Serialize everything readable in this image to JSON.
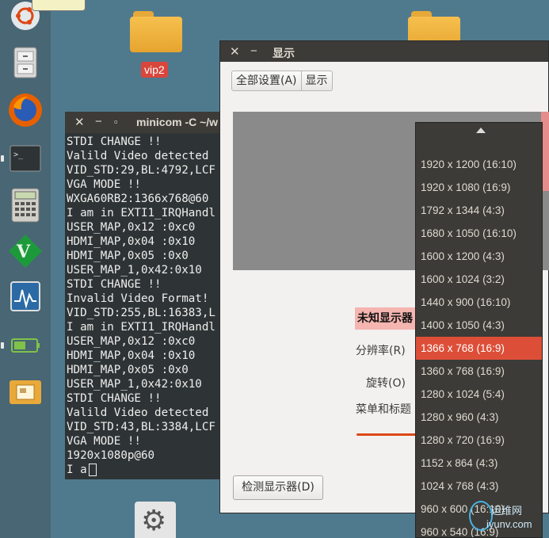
{
  "desktop": {
    "folders": [
      {
        "label": "vip2"
      },
      {
        "label": ""
      }
    ]
  },
  "terminal": {
    "title": "minicom -C ~/w",
    "lines": [
      "STDI CHANGE !!",
      "Valild Video detected",
      "VID_STD:29,BL:4792,LCF",
      "VGA MODE !!",
      "WXGA60RB2:1366x768@60",
      "I am in EXTI1_IRQHandl",
      "USER_MAP,0x12 :0xc0",
      "HDMI_MAP,0x04 :0x10",
      "HDMI_MAP,0x05 :0x0",
      "USER_MAP_1,0x42:0x10",
      "STDI CHANGE !!",
      "Invalid Video Format!",
      "VID_STD:255,BL:16383,L",
      "I am in EXTI1_IRQHandl",
      "USER_MAP,0x12 :0xc0",
      "HDMI_MAP,0x04 :0x10",
      "HDMI_MAP,0x05 :0x0",
      "USER_MAP_1,0x42:0x10",
      "STDI CHANGE !!",
      "Valild Video detected",
      "VID_STD:43,BL:3384,LCF",
      "VGA MODE !!",
      "1920x1080p@60",
      "I a"
    ]
  },
  "dialog": {
    "title": "显示",
    "nav": {
      "all_settings": "全部设置(A)",
      "current": "显示"
    },
    "monitor_name": "未知显示器",
    "resolution_label": "分辨率(R)",
    "rotation_label": "旋转(O)",
    "menu_title_label": "菜单和标题",
    "detect_button": "检测显示器(D)"
  },
  "resolution_menu": {
    "selected_index": 8,
    "options": [
      "1920 x 1200 (16:10)",
      "1920 x 1080 (16:9)",
      "1792 x 1344 (4:3)",
      "1680 x 1050 (16:10)",
      "1600 x 1200 (4:3)",
      "1600 x 1024 (3:2)",
      "1440 x 900 (16:10)",
      "1400 x 1050 (4:3)",
      "1366 x 768 (16:9)",
      "1360 x 768 (16:9)",
      "1280 x 1024 (5:4)",
      "1280 x 960 (4:3)",
      "1280 x 720 (16:9)",
      "1152 x 864 (4:3)",
      "1024 x 768 (4:3)",
      "960 x 600 (16:10)",
      "960 x 540 (16:9)"
    ]
  },
  "watermark": {
    "line1": "运维网",
    "line2": "iyunv.com"
  },
  "colors": {
    "accent": "#dd4e38",
    "desktop": "#4f7a8e",
    "panel": "#3c3b37"
  },
  "icons": {
    "launcher": [
      "ubuntu-logo-icon",
      "file-cabinet-icon",
      "firefox-icon",
      "terminal-icon",
      "calculator-icon",
      "gvim-icon",
      "system-monitor-icon",
      "battery-icon",
      "folder-preview-icon"
    ],
    "settings": "gear-icon"
  }
}
